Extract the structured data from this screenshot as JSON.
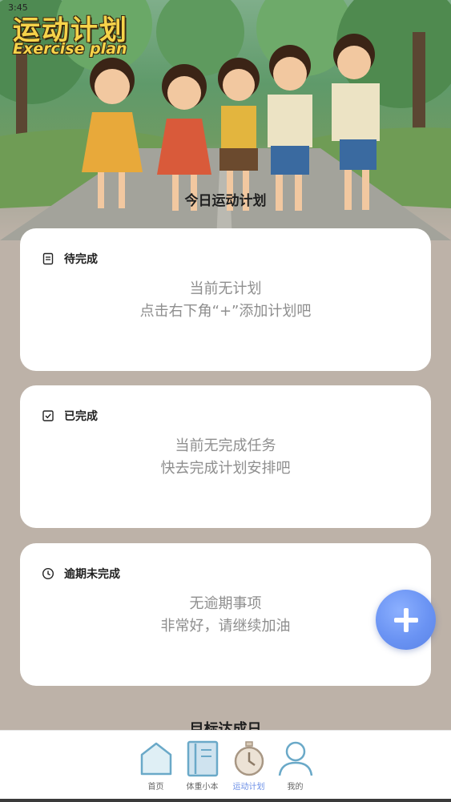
{
  "status_bar": {
    "time": "3:45",
    "right": ""
  },
  "banner": {
    "title": "运动计划",
    "subtitle": "Exercise plan"
  },
  "today_heading": "今日运动计划",
  "cards": [
    {
      "title": "待完成",
      "icon": "document-icon",
      "line1": "当前无计划",
      "line2": "点击右下角“+”添加计划吧"
    },
    {
      "title": "已完成",
      "icon": "checkbox-icon",
      "line1": "当前无完成任务",
      "line2": "快去完成计划安排吧"
    },
    {
      "title": "逾期未完成",
      "icon": "clock-icon",
      "line1": "无逾期事项",
      "line2": "非常好，请继续加油"
    }
  ],
  "goal_heading": "目标达成日",
  "fab_icon": "plus-icon",
  "nav": [
    {
      "label": "首页",
      "icon": "home-icon"
    },
    {
      "label": "体重小本",
      "icon": "notebook-icon"
    },
    {
      "label": "运动计划",
      "icon": "stopwatch-icon",
      "active": true
    },
    {
      "label": "我的",
      "icon": "person-icon"
    }
  ],
  "colors": {
    "background": "#bdb2a8",
    "card": "#ffffff",
    "accent": "#6a93f3",
    "nav_active": "#6a8ee6",
    "title_yellow": "#f6d34a"
  }
}
